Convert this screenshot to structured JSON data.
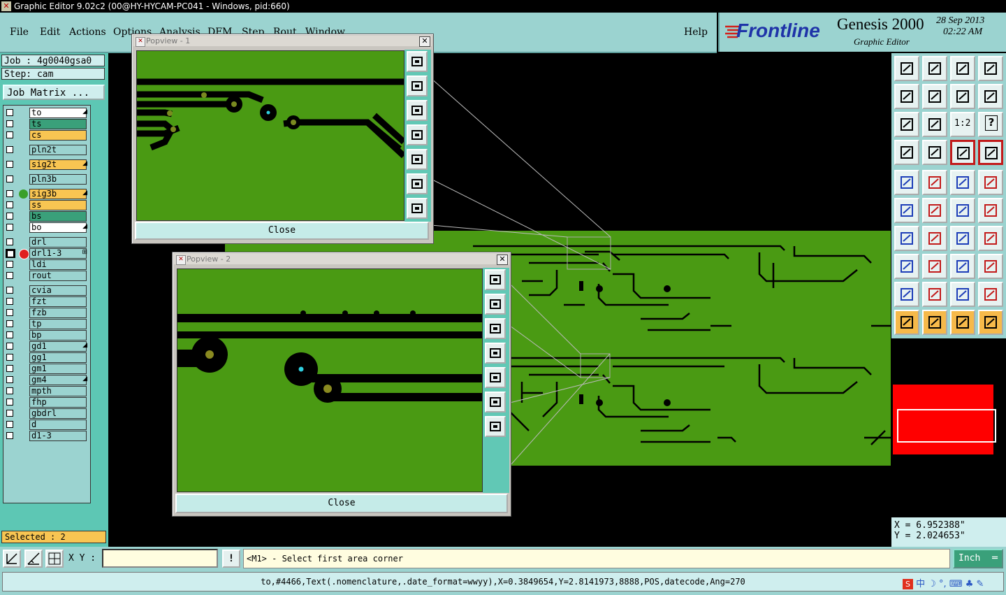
{
  "window": {
    "title": "Graphic Editor 9.02c2 (00@HY-HYCAM-PC041 - Windows, pid:660)"
  },
  "menu": {
    "file": "File",
    "edit": "Edit",
    "actions": "Actions",
    "options": "Options",
    "analysis": "Analysis",
    "dfm": "DFM",
    "step": "Step",
    "rout": "Rout",
    "window": "Window",
    "help": "Help"
  },
  "brand": {
    "logo": "Frontline",
    "product": "Genesis 2000",
    "subtitle": "Graphic Editor",
    "date": "28 Sep 2013",
    "time": "02:22 AM"
  },
  "job": {
    "job": "Job : 4g0040gsa0",
    "step": "Step: cam",
    "matrix": "Job Matrix ..."
  },
  "layers": [
    {
      "name": "to",
      "color": "#ffffff",
      "mark": "◢"
    },
    {
      "name": "ts",
      "color": "#3aa07a",
      "mark": ""
    },
    {
      "name": "cs",
      "color": "#f8c552",
      "mark": ""
    },
    {
      "name": "pln2t",
      "color": "#9bd3d0",
      "mark": ""
    },
    {
      "name": "sig2t",
      "color": "#f8c552",
      "mark": "◢"
    },
    {
      "name": "pln3b",
      "color": "#9bd3d0",
      "mark": ""
    },
    {
      "name": "sig3b",
      "color": "#f8c552",
      "mark": "◢",
      "active": true
    },
    {
      "name": "ss",
      "color": "#f8c552",
      "mark": ""
    },
    {
      "name": "bs",
      "color": "#3aa07a",
      "mark": ""
    },
    {
      "name": "bo",
      "color": "#ffffff",
      "mark": "◢"
    },
    {
      "name": "drl",
      "color": "#9bd3d0",
      "mark": ""
    },
    {
      "name": "drl1-3",
      "color": "#9bd3d0",
      "mark": "⊞",
      "affected": true
    },
    {
      "name": "ldi",
      "color": "#9bd3d0",
      "mark": ""
    },
    {
      "name": "rout",
      "color": "#9bd3d0",
      "mark": ""
    },
    {
      "name": "cvia",
      "color": "#9bd3d0",
      "mark": ""
    },
    {
      "name": "fzt",
      "color": "#9bd3d0",
      "mark": ""
    },
    {
      "name": "fzb",
      "color": "#9bd3d0",
      "mark": ""
    },
    {
      "name": "tp",
      "color": "#9bd3d0",
      "mark": ""
    },
    {
      "name": "bp",
      "color": "#9bd3d0",
      "mark": ""
    },
    {
      "name": "gd1",
      "color": "#9bd3d0",
      "mark": "◢"
    },
    {
      "name": "gg1",
      "color": "#9bd3d0",
      "mark": ""
    },
    {
      "name": "gm1",
      "color": "#9bd3d0",
      "mark": ""
    },
    {
      "name": "gm4",
      "color": "#9bd3d0",
      "mark": "◢"
    },
    {
      "name": "mpth",
      "color": "#9bd3d0",
      "mark": ""
    },
    {
      "name": "fhp",
      "color": "#9bd3d0",
      "mark": ""
    },
    {
      "name": "gbdrl",
      "color": "#9bd3d0",
      "mark": ""
    },
    {
      "name": "d",
      "color": "#9bd3d0",
      "mark": ""
    },
    {
      "name": "d1-3",
      "color": "#9bd3d0",
      "mark": ""
    }
  ],
  "selected": "Selected : 2",
  "popup1": {
    "title": "Popview - 1",
    "close": "Close"
  },
  "popup2": {
    "title": "Popview - 2",
    "close": "Close"
  },
  "tools": {
    "zoom_ratio": "1:2",
    "help": "?"
  },
  "coords": {
    "x": "X = 6.952388\"",
    "y": "Y = 2.024653\""
  },
  "bottom": {
    "xy_label": "X Y :",
    "xy_value": "",
    "alert": "!",
    "prompt": "<M1> - Select first area corner",
    "units": "Inch"
  },
  "status": {
    "text": "to,#4466,Text(.nomenclature,.date_format=wwyy),X=0.3849654,Y=2.8141973,8888,POS,datecode,Ang=270"
  }
}
